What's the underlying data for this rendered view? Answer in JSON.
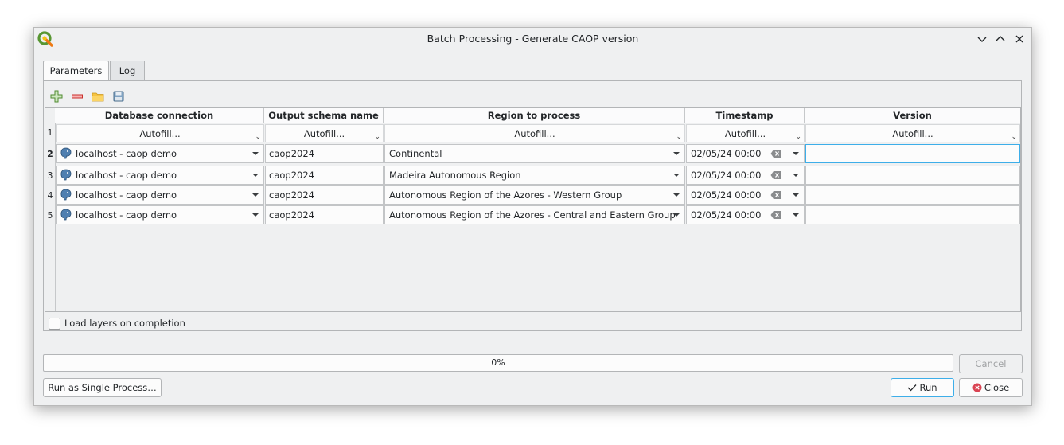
{
  "window": {
    "title": "Batch Processing - Generate CAOP version"
  },
  "tabs": [
    {
      "label": "Parameters"
    },
    {
      "label": "Log"
    }
  ],
  "toolbar": {
    "icons": [
      "add-row-icon",
      "remove-row-icon",
      "open-folder-icon",
      "save-icon"
    ]
  },
  "table": {
    "headers": [
      "Database connection",
      "Output schema name",
      "Region to process",
      "Timestamp",
      "Version"
    ],
    "autofill_row_number": "1",
    "autofill_label": "Autofill...",
    "rows": [
      {
        "num": "2",
        "connection": "localhost - caop demo",
        "schema": "caop2024",
        "region": "Continental",
        "timestamp": "02/05/24 00:00",
        "version": ""
      },
      {
        "num": "3",
        "connection": "localhost - caop demo",
        "schema": "caop2024",
        "region": "Madeira Autonomous Region",
        "timestamp": "02/05/24 00:00",
        "version": ""
      },
      {
        "num": "4",
        "connection": "localhost - caop demo",
        "schema": "caop2024",
        "region": "Autonomous Region of the Azores - Western Group",
        "timestamp": "02/05/24 00:00",
        "version": ""
      },
      {
        "num": "5",
        "connection": "localhost - caop demo",
        "schema": "caop2024",
        "region": "Autonomous Region of the Azores - Central and Eastern Group",
        "timestamp": "02/05/24 00:00",
        "version": ""
      }
    ]
  },
  "load_layers": {
    "label": "Load layers on completion",
    "checked": false
  },
  "progress": {
    "text": "0%",
    "value": 0
  },
  "buttons": {
    "cancel": "Cancel",
    "single": "Run as Single Process…",
    "run": "Run",
    "close": "Close"
  },
  "colors": {
    "accent": "#3daee9",
    "close_red": "#da4453",
    "qgis_green": "#589632"
  }
}
